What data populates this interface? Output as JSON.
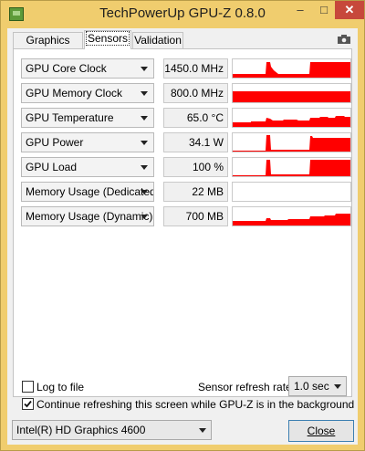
{
  "window": {
    "title": "TechPowerUp GPU-Z 0.8.0"
  },
  "tabs": [
    {
      "label": "Graphics Card"
    },
    {
      "label": "Sensors"
    },
    {
      "label": "Validation"
    }
  ],
  "sensors": [
    {
      "name": "GPU Core Clock",
      "value": "1450.0 MHz"
    },
    {
      "name": "GPU Memory Clock",
      "value": "800.0 MHz"
    },
    {
      "name": "GPU Temperature",
      "value": "65.0 °C"
    },
    {
      "name": "GPU Power",
      "value": "34.1 W"
    },
    {
      "name": "GPU Load",
      "value": "100 %"
    },
    {
      "name": "Memory Usage (Dedicated)",
      "value": "22 MB"
    },
    {
      "name": "Memory Usage (Dynamic)",
      "value": "700 MB"
    }
  ],
  "options": {
    "log_to_file": {
      "label": "Log to file",
      "checked": false
    },
    "continue_refresh": {
      "label": "Continue refreshing this screen while GPU-Z is in the background",
      "checked": true
    },
    "refresh_rate_label": "Sensor refresh rate:",
    "refresh_rate_value": "1.0 sec"
  },
  "gpu_select": {
    "value": "Intel(R) HD Graphics 4600"
  },
  "buttons": {
    "close": "Close"
  },
  "colors": {
    "graph": "#ff0000",
    "title_bar": "#f0cd6e",
    "accent": "#3c7fb1"
  }
}
